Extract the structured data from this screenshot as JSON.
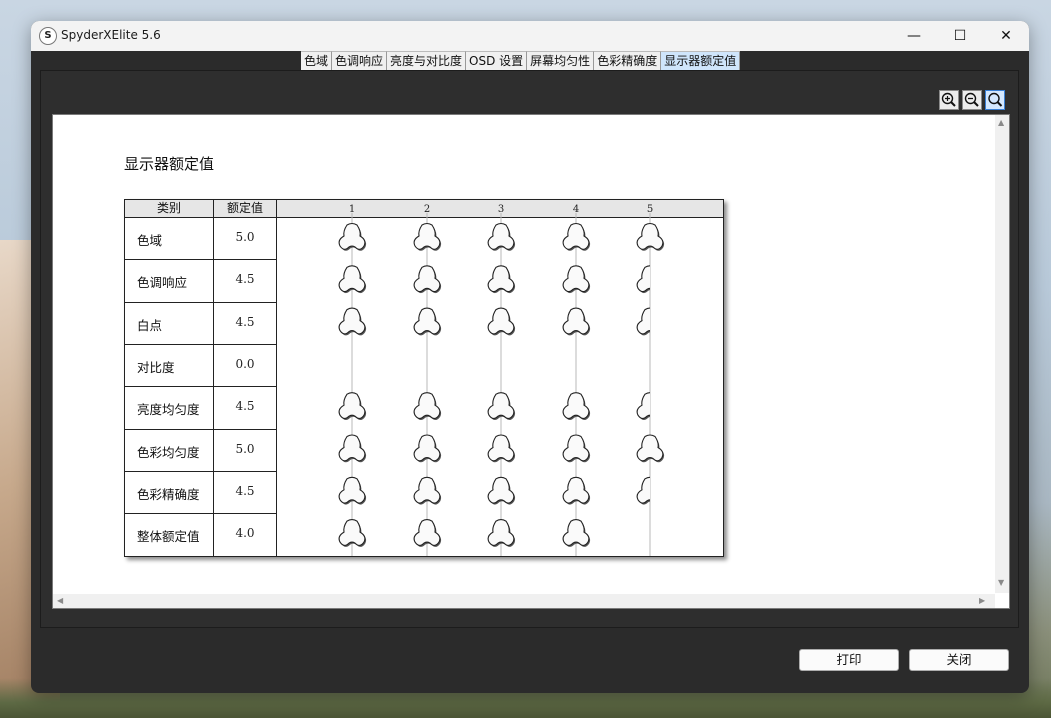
{
  "window": {
    "title": "SpyderXElite 5.6",
    "app_icon_letter": "S",
    "controls": {
      "minimize": "—",
      "maximize": "☐",
      "close": "✕"
    }
  },
  "tabs": [
    {
      "label": "色域",
      "active": false
    },
    {
      "label": "色调响应",
      "active": false
    },
    {
      "label": "亮度与对比度",
      "active": false
    },
    {
      "label": "OSD 设置",
      "active": false
    },
    {
      "label": "屏幕均匀性",
      "active": false
    },
    {
      "label": "色彩精确度",
      "active": false
    },
    {
      "label": "显示器额定值",
      "active": true
    }
  ],
  "zoom_tools": [
    {
      "icon": "zoom-in-icon",
      "active": false
    },
    {
      "icon": "zoom-out-icon",
      "active": false
    },
    {
      "icon": "zoom-fit-icon",
      "active": true
    }
  ],
  "report": {
    "title": "显示器额定值",
    "headers": {
      "category": "类别",
      "value": "额定值"
    },
    "scale_ticks": [
      "1",
      "2",
      "3",
      "4",
      "5"
    ],
    "rows": [
      {
        "category": "色域",
        "value_text": "5.0",
        "rating": 5.0
      },
      {
        "category": "色调响应",
        "value_text": "4.5",
        "rating": 4.5
      },
      {
        "category": "白点",
        "value_text": "4.5",
        "rating": 4.5
      },
      {
        "category": "对比度",
        "value_text": "0.0",
        "rating": 0.0
      },
      {
        "category": "亮度均匀度",
        "value_text": "4.5",
        "rating": 4.5
      },
      {
        "category": "色彩均匀度",
        "value_text": "5.0",
        "rating": 5.0
      },
      {
        "category": "色彩精确度",
        "value_text": "4.5",
        "rating": 4.5
      },
      {
        "category": "整体额定值",
        "value_text": "4.0",
        "rating": 4.0
      }
    ]
  },
  "buttons": {
    "print": "打印",
    "close": "关闭"
  },
  "colors": {
    "active_tab": "#cfe5fb",
    "window_bg": "#2b2b2b",
    "report_bg": "#ffffff"
  }
}
